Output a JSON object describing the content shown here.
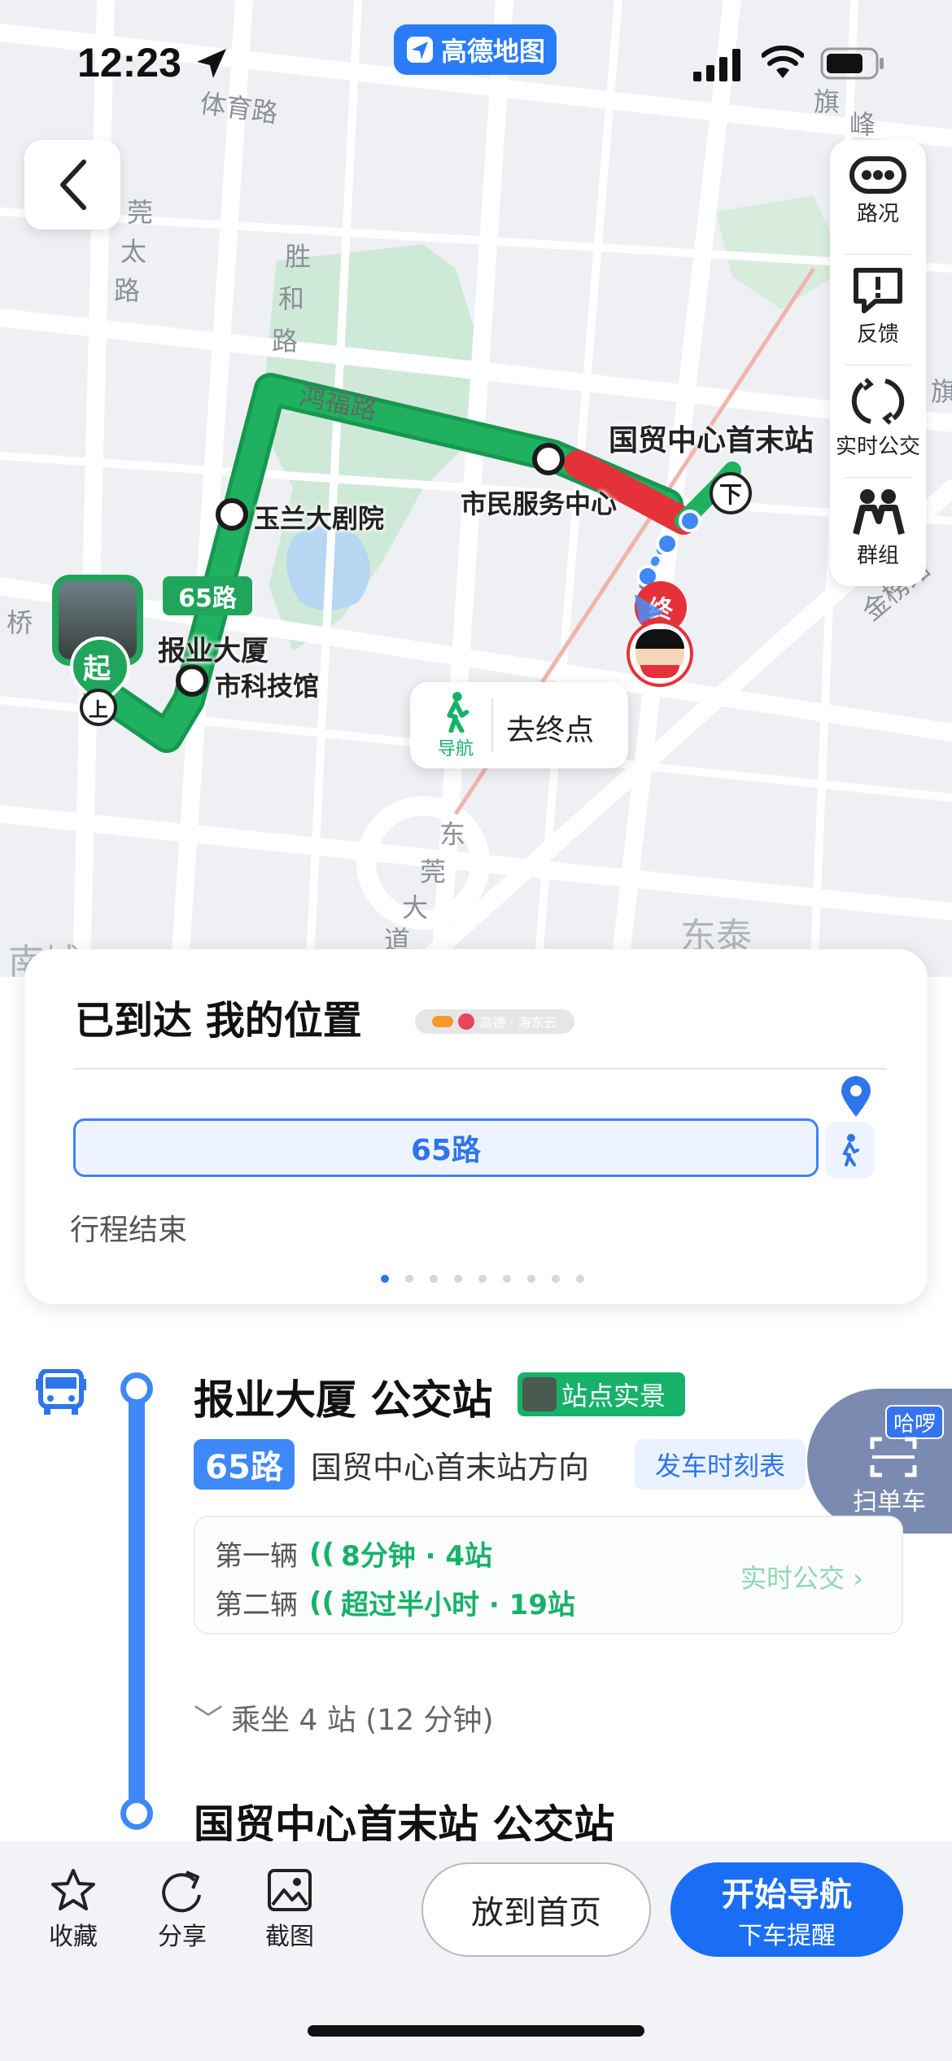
{
  "status_bar": {
    "time": "12:23",
    "app_name": "高德地图"
  },
  "map_tools": [
    {
      "label": "路况",
      "icon": "traffic-icon"
    },
    {
      "label": "反馈",
      "icon": "feedback-icon"
    },
    {
      "label": "实时公交",
      "icon": "realtime-bus-icon"
    },
    {
      "label": "群组",
      "icon": "group-icon"
    }
  ],
  "map": {
    "roads": [
      "体育路",
      "胜",
      "和",
      "路",
      "鸿福路",
      "莞",
      "太",
      "路",
      "旗",
      "峰",
      "金榜路",
      "东",
      "莞",
      "大",
      "道",
      "东泰",
      "南城",
      "桥",
      "旗"
    ],
    "stops": [
      "国贸中心首末站",
      "市民服务中心",
      "玉兰大剧院",
      "报业大厦",
      "市科技馆"
    ],
    "route_tag": "65路",
    "start_marker": "起",
    "end_marker": "终",
    "exit_marker": "下",
    "board_marker": "上",
    "walk_nav": {
      "icon_label": "导航",
      "label": "去终点"
    }
  },
  "info_card": {
    "title": "已到达  我的位置",
    "partner": "高德 · 海东云",
    "route_label": "65路",
    "status": "行程结束",
    "page_count": 9,
    "active_page": 0
  },
  "detail": {
    "board_stop": "报业大厦 公交站",
    "scene_tag": "站点实景",
    "line": "65路",
    "direction": "国贸中心首末站方向",
    "timetable": "发车时刻表",
    "haluo": {
      "tag": "哈啰",
      "label": "扫单车"
    },
    "realtime": {
      "first_label": "第一辆",
      "first_value": "8分钟 · 4站",
      "second_label": "第二辆",
      "second_value": "超过半小时 · 19站",
      "link": "实时公交 ›"
    },
    "ride_info": "乘坐 4 站 (12 分钟)",
    "end_stop": "国贸中心首末站 公交站"
  },
  "bottom_bar": {
    "collect": "收藏",
    "share": "分享",
    "screenshot": "截图",
    "home": "放到首页",
    "nav_main": "开始导航",
    "nav_sub": "下车提醒"
  },
  "colors": {
    "route_green": "#1fa55c",
    "congestion_red": "#e5323a",
    "accent_blue": "#1a6ef5"
  }
}
